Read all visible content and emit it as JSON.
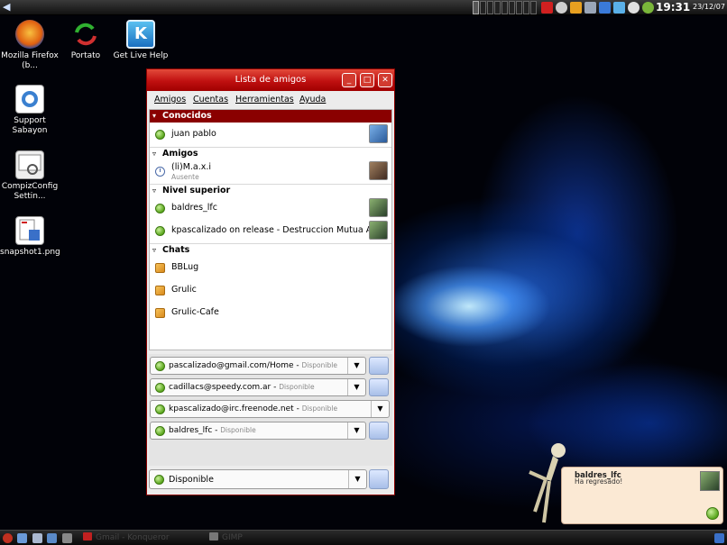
{
  "topbar": {
    "clock": "19:31",
    "date": "23/12/07"
  },
  "desktop": {
    "icons": [
      {
        "label": "Mozilla Firefox (b..."
      },
      {
        "label": "Portato"
      },
      {
        "label": "Get Live Help"
      },
      {
        "label": "Support Sabayon"
      },
      {
        "label": "CompizConfig Settin..."
      },
      {
        "label": "snapshot1.png"
      }
    ]
  },
  "window": {
    "title": "Lista de amigos",
    "menu": [
      "Amigos",
      "Cuentas",
      "Herramientas",
      "Ayuda"
    ],
    "groups": [
      {
        "name": "Conocidos"
      },
      {
        "name": "Amigos"
      },
      {
        "name": "Nivel superior"
      },
      {
        "name": "Chats"
      }
    ],
    "buddies": [
      {
        "name": "juan pablo",
        "sub": ""
      },
      {
        "name": "(li)M.a.x.i",
        "sub": "Ausente"
      },
      {
        "name": "baldres_lfc",
        "sub": ""
      },
      {
        "name": "kpascalizado on release - Destruccion Mutua A...",
        "sub": ""
      }
    ],
    "chats": [
      "BBLug",
      "Grulic",
      "Grulic-Cafe"
    ],
    "accounts": [
      {
        "account": "pascalizado@gmail.com/Home",
        "status": "Disponible"
      },
      {
        "account": "cadillacs@speedy.com.ar",
        "status": "Disponible"
      },
      {
        "account": "kpascalizado@irc.freenode.net",
        "status": "Disponible"
      },
      {
        "account": "baldres_lfc",
        "status": "Disponible"
      }
    ],
    "global_status": "Disponible"
  },
  "notification": {
    "buddy": "baldres_lfc",
    "message": "Ha regresado!"
  },
  "taskbar": {
    "tasks": [
      "Gmail - Konqueror",
      "GIMP"
    ]
  }
}
